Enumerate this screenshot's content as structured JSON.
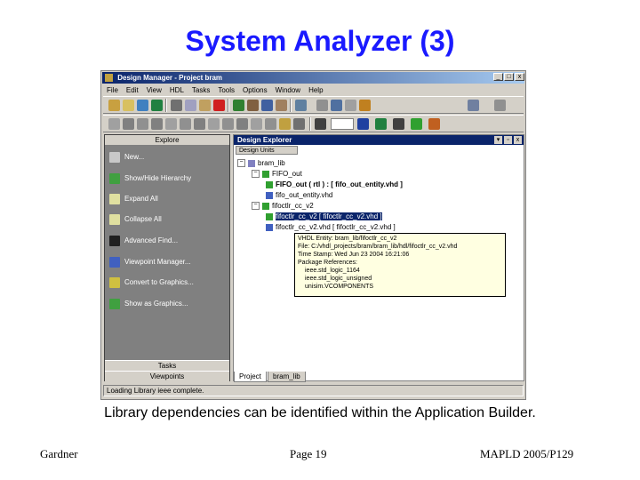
{
  "slide": {
    "title": "System Analyzer (3)",
    "caption": "Library dependencies can be identified within the Application Builder.",
    "footer_left": "Gardner",
    "footer_center": "Page 19",
    "footer_right": "MAPLD 2005/P129"
  },
  "window": {
    "title": "Design Manager - Project bram",
    "controls": [
      "_",
      "□",
      "x"
    ],
    "menu": [
      "File",
      "Edit",
      "View",
      "HDL",
      "Tasks",
      "Tools",
      "Options",
      "Window",
      "Help"
    ]
  },
  "explore": {
    "header": "Explore",
    "items": [
      {
        "label": "New...",
        "icon": "new-icon"
      },
      {
        "label": "Show/Hide Hierarchy",
        "icon": "hierarchy-icon"
      },
      {
        "label": "Expand All",
        "icon": "expand-all-icon"
      },
      {
        "label": "Collapse All",
        "icon": "collapse-all-icon"
      },
      {
        "label": "Advanced Find...",
        "icon": "binoculars-icon"
      },
      {
        "label": "Viewpoint Manager...",
        "icon": "viewpoint-manager-icon"
      },
      {
        "label": "Convert to Graphics...",
        "icon": "convert-graphics-icon"
      },
      {
        "label": "Show as Graphics...",
        "icon": "show-graphics-icon"
      }
    ],
    "tasks_bar": "Tasks",
    "viewpoints_bar": "Viewpoints"
  },
  "explorer": {
    "title": "Design Explorer",
    "column_header": "Design Units",
    "tree": [
      "bram_lib",
      "FIFO_out",
      "FIFO_out ( rtl ) : [ fifo_out_entity.vhd ]",
      "fifo_out_entity.vhd",
      "fifoctlr_cc_v2",
      "fifoctlr_cc_v2 [ fifoctlr_cc_v2.vhd ]",
      "fifoctlr_cc_v2.vhd [ fifoctlr_cc_v2.vhd ]"
    ],
    "tooltip": [
      "VHDL Entity: bram_lib/fifoctlr_cc_v2",
      "File: C:/vhdl_projects/bram/bram_lib/hdl/fifoctlr_cc_v2.vhd",
      "Time Stamp: Wed Jun 23 2004 16:21:06",
      "Package References:",
      "ieee.std_logic_1164",
      "ieee.std_logic_unsigned",
      "unisim.VCOMPONENTS"
    ],
    "tabs": [
      "Project",
      "bram_lib"
    ]
  },
  "status_bar": "Loading Library ieee complete."
}
